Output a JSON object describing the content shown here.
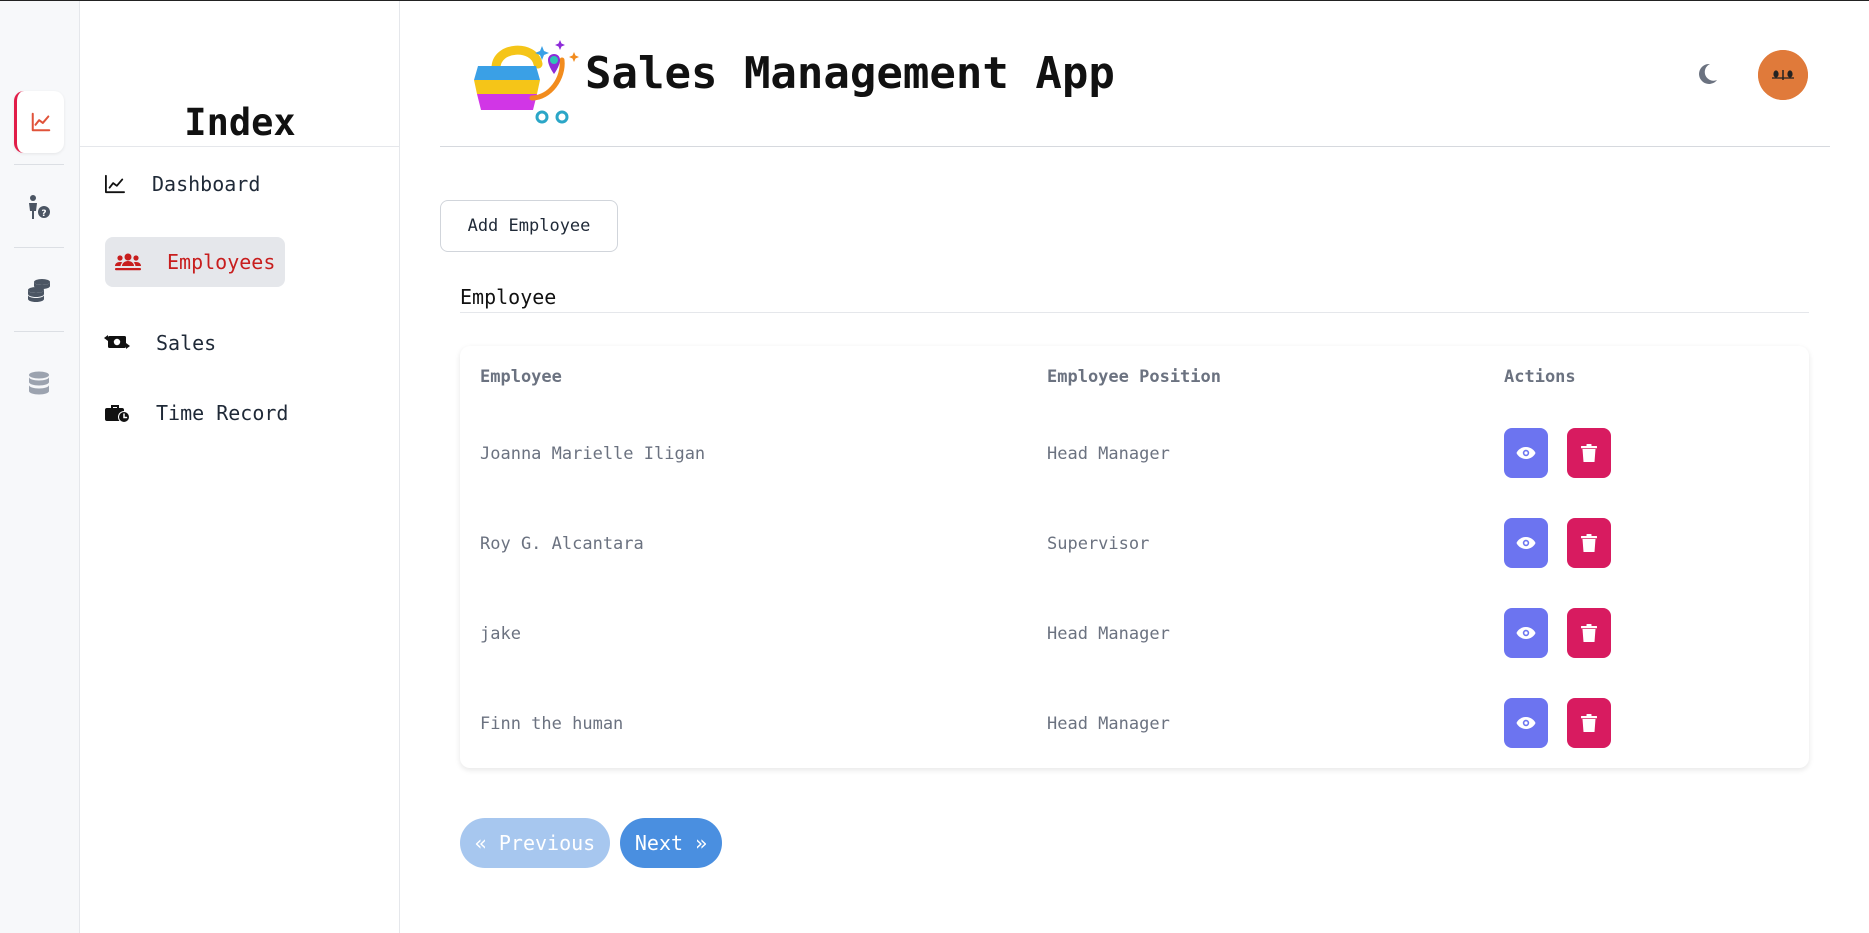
{
  "app": {
    "title": "Sales Management App"
  },
  "sidebar": {
    "title": "Index",
    "items": [
      {
        "label": "Dashboard",
        "icon": "chart-line-icon",
        "active": false
      },
      {
        "label": "Employees",
        "icon": "users-icon",
        "active": true
      },
      {
        "label": "Sales",
        "icon": "money-exchange-icon",
        "active": false
      },
      {
        "label": "Time Record",
        "icon": "briefcase-clock-icon",
        "active": false
      }
    ]
  },
  "rail": {
    "icons": [
      "chart-line-icon",
      "person-question-icon",
      "coins-icon",
      "database-icon"
    ]
  },
  "toolbar": {
    "add_label": "Add Employee"
  },
  "section": {
    "label": "Employee"
  },
  "table": {
    "headers": [
      "Employee",
      "Employee Position",
      "Actions"
    ],
    "rows": [
      {
        "name": "Joanna Marielle Iligan",
        "position": "Head Manager"
      },
      {
        "name": "Roy G. Alcantara",
        "position": "Supervisor"
      },
      {
        "name": "jake",
        "position": "Head Manager"
      },
      {
        "name": "Finn the human",
        "position": "Head Manager"
      }
    ]
  },
  "pagination": {
    "previous_label": "« Previous",
    "next_label": "Next »"
  },
  "colors": {
    "accent": "#e11d48",
    "view_button": "#6c74f0",
    "delete_button": "#d81b60",
    "next_button": "#4a8fe0",
    "previous_button": "#a7c7ef",
    "avatar": "#e07a3a"
  }
}
